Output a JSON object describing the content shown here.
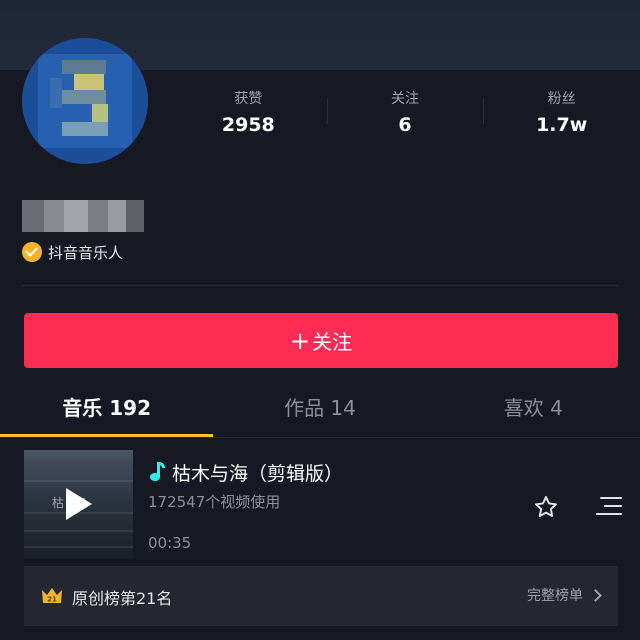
{
  "profile": {
    "stats": [
      {
        "label": "获赞",
        "value": "2958"
      },
      {
        "label": "关注",
        "value": "6"
      },
      {
        "label": "粉丝",
        "value": "1.7w"
      }
    ],
    "verified_label": "抖音音乐人"
  },
  "follow_button": {
    "plus": "+",
    "label": "关注"
  },
  "tabs": [
    {
      "label": "音乐 192",
      "active": true
    },
    {
      "label": "作品 14",
      "active": false
    },
    {
      "label": "喜欢 4",
      "active": false
    }
  ],
  "track": {
    "title": "枯木与海（剪辑版）",
    "usage": "172547个视频使用",
    "duration": "00:35",
    "cover_text": "枯海"
  },
  "ranking": {
    "badge": "21",
    "text": "原创榜第21名",
    "link": "完整榜单"
  },
  "colors": {
    "accent": "#fe2c55",
    "tab_indicator": "#fdc12f",
    "verified": "#f5b42a",
    "note": "#25f4ee",
    "background": "#161823"
  }
}
